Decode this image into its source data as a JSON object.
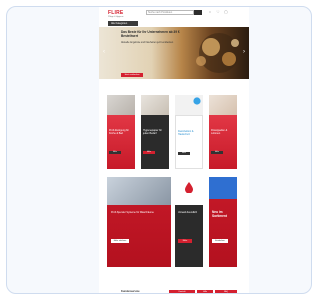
{
  "brand": {
    "logo": "FLIRE",
    "tagline": "Pflege & Hygiene"
  },
  "header": {
    "search_placeholder": "Suche nach Produkten",
    "nav_button": "Alle Kategorien"
  },
  "hero": {
    "title": "Das Beste für Ihr Unternehmen ab 39 € Bestellwert",
    "subtitle": "Aktuelle Angebote und Neuheiten jetzt entdecken",
    "cta": "Jetzt entdecken"
  },
  "products": [
    {
      "title": "Profi-Reinigung für Küche & Bad",
      "button": "Mehr"
    },
    {
      "title": "Hygienepapier für jeden Bedarf",
      "button": "Mehr"
    },
    {
      "title": "Desinfektion & Hautschutz",
      "button": "Mehr"
    },
    {
      "title": "Flüssigseifen & Lotionen",
      "button": "Mehr"
    }
  ],
  "promos": [
    {
      "title": "Profi-Spender Systeme für Waschräume",
      "button": "Mehr erfahren"
    },
    {
      "title": "Umwelt-freundlich",
      "button": "Mehr"
    },
    {
      "title": "Neu im Sortiment",
      "button": "Entdecken"
    }
  ],
  "footer": {
    "label": "Kundenservice",
    "tabs": [
      "Kontakt",
      "Hilfe",
      "FAQ"
    ]
  },
  "colors": {
    "brand": "#d4202f",
    "dark": "#2c2c2c",
    "card_border": "#cfdcef"
  },
  "icons": [
    "search-icon",
    "user-icon",
    "heart-icon",
    "cart-icon",
    "chevron-left-icon",
    "chevron-right-icon"
  ]
}
